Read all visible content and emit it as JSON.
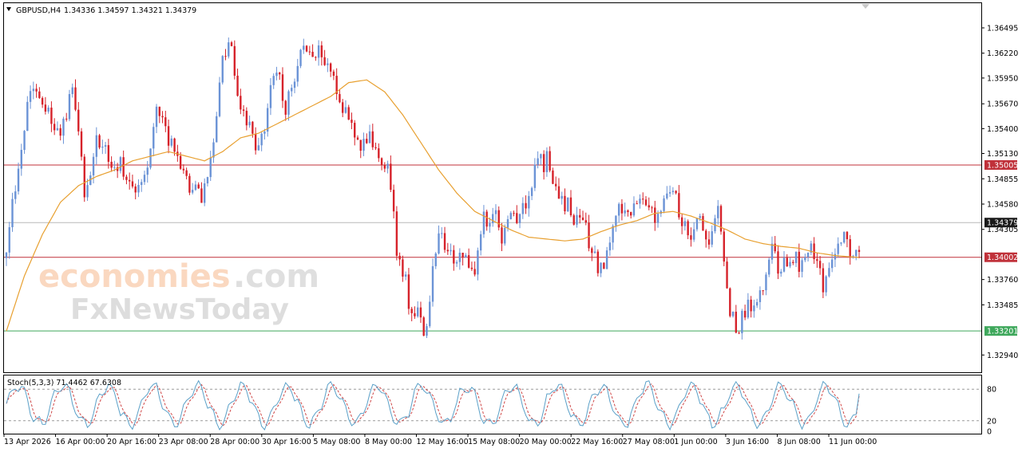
{
  "header": {
    "symbol": "GBPUSD,H4",
    "ohlc": "1.34336 1.34597 1.34321 1.34379"
  },
  "watermark": {
    "line1_main": "economies",
    "line1_suffix": ".com",
    "line2": "FxNewsToday",
    "logo_text": "economies.com FxNewsToday"
  },
  "stoch_label": "Stoch(5,3,3) 71.4462 67.6308",
  "colors": {
    "bull": "#6b93d6",
    "bear": "#d6222a",
    "ma": "#e8a030",
    "resistance": "#c0313a",
    "support": "#3fa85c",
    "current_price": "#1a1a1a",
    "stoch_main": "#5aa0c8",
    "stoch_signal": "#d04848"
  },
  "chart_data": {
    "type": "candlestick",
    "symbol": "GBPUSD",
    "timeframe": "H4",
    "y_range": [
      1.3283,
      1.3672
    ],
    "y_ticks": [
      "1.36495",
      "1.36220",
      "1.35950",
      "1.35670",
      "1.35400",
      "1.35130",
      "1.34855",
      "1.34580",
      "1.34305",
      "1.33760",
      "1.33485",
      "1.32940"
    ],
    "x_labels": [
      "13 Apr 2026",
      "16 Apr 00:00",
      "20 Apr 16:00",
      "23 Apr 08:00",
      "28 Apr 00:00",
      "30 Apr 16:00",
      "5 May 08:00",
      "8 May 00:00",
      "12 May 16:00",
      "15 May 08:00",
      "20 May 00:00",
      "22 May 16:00",
      "27 May 08:00",
      "1 Jun 00:00",
      "3 Jun 16:00",
      "8 Jun 08:00",
      "11 Jun 00:00"
    ],
    "levels": [
      {
        "label": "1.35005",
        "value": 1.35005,
        "kind": "resistance"
      },
      {
        "label": "1.34379",
        "value": 1.34379,
        "kind": "current_price"
      },
      {
        "label": "1.34002",
        "value": 1.34002,
        "kind": "resistance"
      },
      {
        "label": "1.33201",
        "value": 1.33201,
        "kind": "support"
      }
    ],
    "close_path": [
      [
        0,
        1.341
      ],
      [
        4,
        1.35
      ],
      [
        7,
        1.357
      ],
      [
        9,
        1.3578
      ],
      [
        14,
        1.356
      ],
      [
        18,
        1.3525
      ],
      [
        22,
        1.359
      ],
      [
        26,
        1.347
      ],
      [
        30,
        1.353
      ],
      [
        34,
        1.3505
      ],
      [
        38,
        1.35
      ],
      [
        42,
        1.3475
      ],
      [
        46,
        1.349
      ],
      [
        50,
        1.356
      ],
      [
        54,
        1.3525
      ],
      [
        58,
        1.3505
      ],
      [
        62,
        1.347
      ],
      [
        66,
        1.347
      ],
      [
        69,
        1.352
      ],
      [
        72,
        1.361
      ],
      [
        75,
        1.363
      ],
      [
        77,
        1.358
      ],
      [
        80,
        1.3545
      ],
      [
        84,
        1.352
      ],
      [
        87,
        1.356
      ],
      [
        90,
        1.361
      ],
      [
        93,
        1.3555
      ],
      [
        96,
        1.36
      ],
      [
        99,
        1.364
      ],
      [
        102,
        1.361
      ],
      [
        105,
        1.3625
      ],
      [
        108,
        1.36
      ],
      [
        111,
        1.3575
      ],
      [
        114,
        1.3545
      ],
      [
        117,
        1.352
      ],
      [
        120,
        1.3535
      ],
      [
        123,
        1.3515
      ],
      [
        126,
        1.3505
      ],
      [
        128,
        1.348
      ],
      [
        130,
        1.341
      ],
      [
        132,
        1.339
      ],
      [
        134,
        1.3355
      ],
      [
        136,
        1.3345
      ],
      [
        138,
        1.333
      ],
      [
        140,
        1.332
      ],
      [
        142,
        1.3395
      ],
      [
        144,
        1.343
      ],
      [
        147,
        1.3405
      ],
      [
        150,
        1.3395
      ],
      [
        153,
        1.3405
      ],
      [
        156,
        1.338
      ],
      [
        159,
        1.344
      ],
      [
        162,
        1.345
      ],
      [
        165,
        1.3425
      ],
      [
        168,
        1.344
      ],
      [
        171,
        1.345
      ],
      [
        174,
        1.347
      ],
      [
        177,
        1.35
      ],
      [
        180,
        1.3505
      ],
      [
        183,
        1.348
      ],
      [
        186,
        1.346
      ],
      [
        189,
        1.3445
      ],
      [
        192,
        1.344
      ],
      [
        195,
        1.3405
      ],
      [
        198,
        1.3385
      ],
      [
        201,
        1.342
      ],
      [
        204,
        1.345
      ],
      [
        207,
        1.344
      ],
      [
        210,
        1.3465
      ],
      [
        213,
        1.346
      ],
      [
        216,
        1.3445
      ],
      [
        219,
        1.3465
      ],
      [
        222,
        1.347
      ],
      [
        225,
        1.3445
      ],
      [
        228,
        1.3425
      ],
      [
        231,
        1.344
      ],
      [
        234,
        1.3415
      ],
      [
        237,
        1.346
      ],
      [
        239,
        1.34
      ],
      [
        241,
        1.3345
      ],
      [
        243,
        1.332
      ],
      [
        246,
        1.334
      ],
      [
        249,
        1.335
      ],
      [
        252,
        1.3375
      ],
      [
        255,
        1.3405
      ],
      [
        258,
        1.3385
      ],
      [
        261,
        1.3405
      ],
      [
        264,
        1.3395
      ],
      [
        267,
        1.341
      ],
      [
        270,
        1.3395
      ],
      [
        272,
        1.337
      ],
      [
        274,
        1.339
      ],
      [
        276,
        1.341
      ],
      [
        279,
        1.342
      ],
      [
        282,
        1.3405
      ],
      [
        284,
        1.34
      ]
    ],
    "ma_path": [
      [
        0,
        1.332
      ],
      [
        6,
        1.338
      ],
      [
        12,
        1.3425
      ],
      [
        18,
        1.346
      ],
      [
        24,
        1.3478
      ],
      [
        30,
        1.3488
      ],
      [
        36,
        1.3495
      ],
      [
        42,
        1.3505
      ],
      [
        48,
        1.351
      ],
      [
        54,
        1.3515
      ],
      [
        60,
        1.351
      ],
      [
        66,
        1.3505
      ],
      [
        72,
        1.3515
      ],
      [
        78,
        1.353
      ],
      [
        84,
        1.3535
      ],
      [
        90,
        1.3545
      ],
      [
        96,
        1.3555
      ],
      [
        102,
        1.3565
      ],
      [
        108,
        1.3575
      ],
      [
        114,
        1.359
      ],
      [
        120,
        1.3593
      ],
      [
        126,
        1.358
      ],
      [
        132,
        1.3555
      ],
      [
        138,
        1.3525
      ],
      [
        144,
        1.3495
      ],
      [
        150,
        1.347
      ],
      [
        156,
        1.345
      ],
      [
        162,
        1.344
      ],
      [
        168,
        1.343
      ],
      [
        174,
        1.3422
      ],
      [
        180,
        1.342
      ],
      [
        186,
        1.3418
      ],
      [
        192,
        1.342
      ],
      [
        198,
        1.3428
      ],
      [
        204,
        1.3435
      ],
      [
        210,
        1.344
      ],
      [
        216,
        1.3448
      ],
      [
        222,
        1.345
      ],
      [
        228,
        1.3445
      ],
      [
        234,
        1.3438
      ],
      [
        240,
        1.343
      ],
      [
        246,
        1.342
      ],
      [
        252,
        1.3415
      ],
      [
        258,
        1.3412
      ],
      [
        264,
        1.341
      ],
      [
        270,
        1.3405
      ],
      [
        276,
        1.3402
      ],
      [
        284,
        1.34
      ]
    ],
    "candle_count": 285,
    "stochastic": {
      "params": "5,3,3",
      "main": 71.4462,
      "signal": 67.6308,
      "range": [
        0,
        100
      ],
      "ticks": [
        "80",
        "20",
        "0"
      ],
      "levels": [
        80,
        20
      ]
    }
  }
}
